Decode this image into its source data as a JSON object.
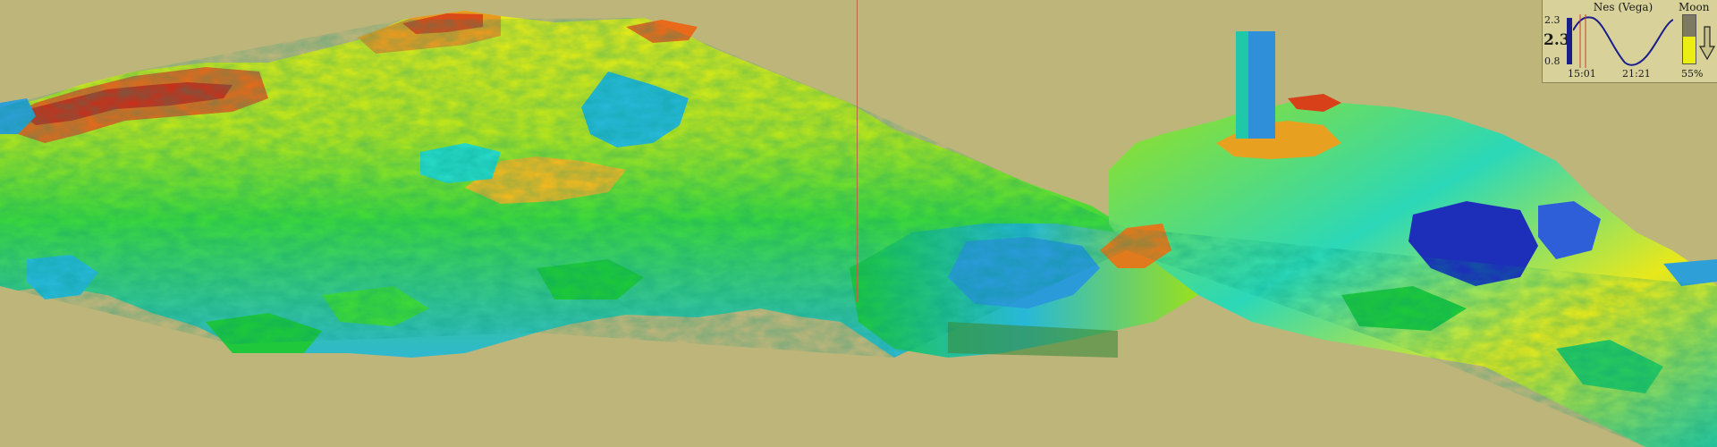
{
  "scene": {
    "background_color": "#bdb57a",
    "terrain_palette": [
      "#1d2fb8",
      "#2f8fd8",
      "#27d8c8",
      "#1ec83a",
      "#9ae01c",
      "#e8e81a",
      "#f0b820",
      "#e05a18",
      "#c8201a"
    ]
  },
  "tide_widget": {
    "location": "Nes (Vega)",
    "max_level": "2.3",
    "current_level": "2.3",
    "min_level": "0.8",
    "time_high": "15:01",
    "time_low": "21:21",
    "current_fraction": 0.98
  },
  "moon": {
    "label": "Moon",
    "illumination": "55%",
    "illumination_fraction": 0.55,
    "trend_icon": "down-arrow-icon"
  }
}
